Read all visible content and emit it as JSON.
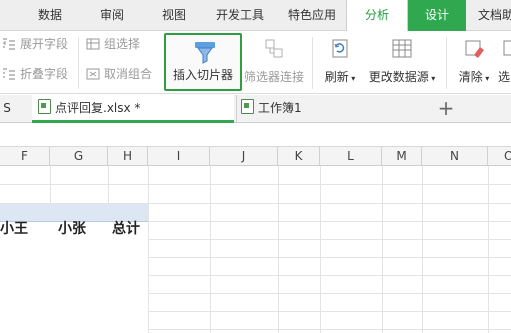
{
  "menu_tabs": [
    "数据",
    "审阅",
    "视图",
    "开发工具",
    "特色应用",
    "分析",
    "设计",
    "文档助"
  ],
  "ribbon": {
    "expand_field": "展开字段",
    "collapse_field": "折叠字段",
    "group_select": "组选择",
    "ungroup": "取消组合",
    "insert_slicer": "插入切片器",
    "filter_connections": "筛选器连接",
    "refresh": "刷新",
    "change_data_source": "更改数据源",
    "clear": "清除",
    "select_partial": "选"
  },
  "doc_tabs": {
    "left_fragment": "S",
    "active_file": "点评回复.xlsx *",
    "workbook": "工作簿1",
    "new_tab": "+"
  },
  "columns": [
    "F",
    "G",
    "H",
    "I",
    "J",
    "K",
    "L",
    "M",
    "N",
    "O"
  ],
  "cells": {
    "xiaowang": "小王",
    "xiaozhang": "小张",
    "total": "总计"
  },
  "colors": {
    "accent_green": "#2fa84f",
    "header_band": "#dde7f3"
  }
}
